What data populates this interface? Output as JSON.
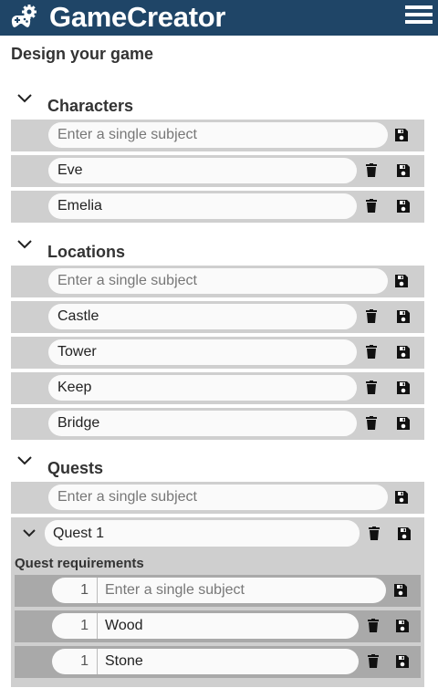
{
  "header": {
    "app_title": "GameCreator",
    "logo_icon": "gamepad-gear-icon",
    "menu_icon": "hamburger-menu-icon"
  },
  "page_title": "Design your game",
  "placeholder": "Enter a single subject",
  "sections": {
    "characters": {
      "title": "Characters",
      "items": [
        "Eve",
        "Emelia"
      ]
    },
    "locations": {
      "title": "Locations",
      "items": [
        "Castle",
        "Tower",
        "Keep",
        "Bridge"
      ]
    },
    "quests": {
      "title": "Quests",
      "quest": {
        "name": "Quest 1",
        "requirements_label": "Quest requirements",
        "new_quantity": "1",
        "requirements": [
          {
            "quantity": "1",
            "name": "Wood"
          },
          {
            "quantity": "1",
            "name": "Stone"
          }
        ]
      }
    }
  },
  "colors": {
    "header_bg": "#1f4567",
    "row_bg": "#cfcfcf",
    "requirement_row_bg": "#a9a9a9"
  }
}
